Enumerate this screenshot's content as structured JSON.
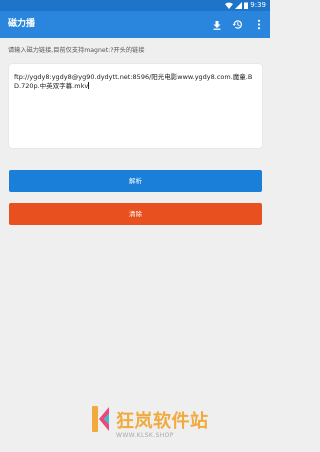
{
  "status_bar": {
    "time": "9:39"
  },
  "app_bar": {
    "title": "磁力播",
    "icons": [
      "download-icon",
      "history-icon",
      "more-vert-icon"
    ]
  },
  "hint": "请输入磁力链接,目前仅支持magnet:?开头的链接",
  "input": {
    "value": "ftp://ygdy8:ygdy8@yg90.dydytt.net:8596/阳光电影www.ygdy8.com.魔童.BD.720p.中英双字幕.mkv"
  },
  "buttons": {
    "parse_label": "解析",
    "clear_label": "清除"
  },
  "watermark": {
    "title": "狂岚软件站",
    "url": "WWW.KLSK.SHOP"
  },
  "colors": {
    "status_bar": "#1e74c8",
    "app_bar": "#2a86dd",
    "parse_button": "#1a7fd8",
    "clear_button": "#e8511f",
    "background": "#efefef"
  }
}
